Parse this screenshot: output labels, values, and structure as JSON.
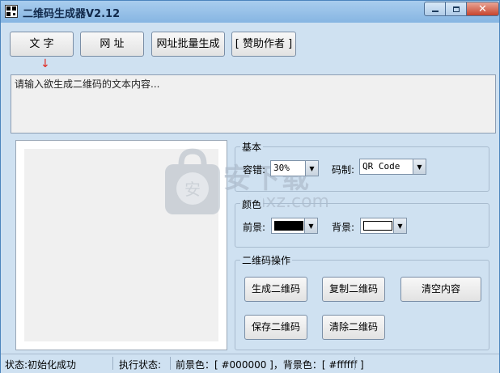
{
  "window": {
    "title": "二维码生成器V2.12",
    "controls": {
      "close_glyph": "✕"
    }
  },
  "toolbar": {
    "text_label": "文  字",
    "url_label": "网  址",
    "batch_label": "网址批量生成",
    "donate_label": "[ 赞助作者 ]"
  },
  "input": {
    "placeholder": "请输入欲生成二维码的文本内容..."
  },
  "basic": {
    "title": "基本",
    "tolerance_label": "容错:",
    "tolerance_value": "30%",
    "code_label": "码制:",
    "code_value": "QR Code"
  },
  "colors": {
    "title": "颜色",
    "foreground_label": "前景:",
    "foreground_color": "#000000",
    "background_label": "背景:",
    "background_color": "#ffffff"
  },
  "ops": {
    "title": "二维码操作",
    "generate": "生成二维码",
    "copy": "复制二维码",
    "clear_content": "清空内容",
    "save": "保存二维码",
    "clear_qr": "清除二维码"
  },
  "status": {
    "state": "状态:初始化成功",
    "exec": "执行状态:",
    "colors_info": "前景色：[ #000000 ]，背景色：[ #ffffff ]"
  },
  "watermark": {
    "text": "安下载",
    "sub": "anxz.com"
  }
}
